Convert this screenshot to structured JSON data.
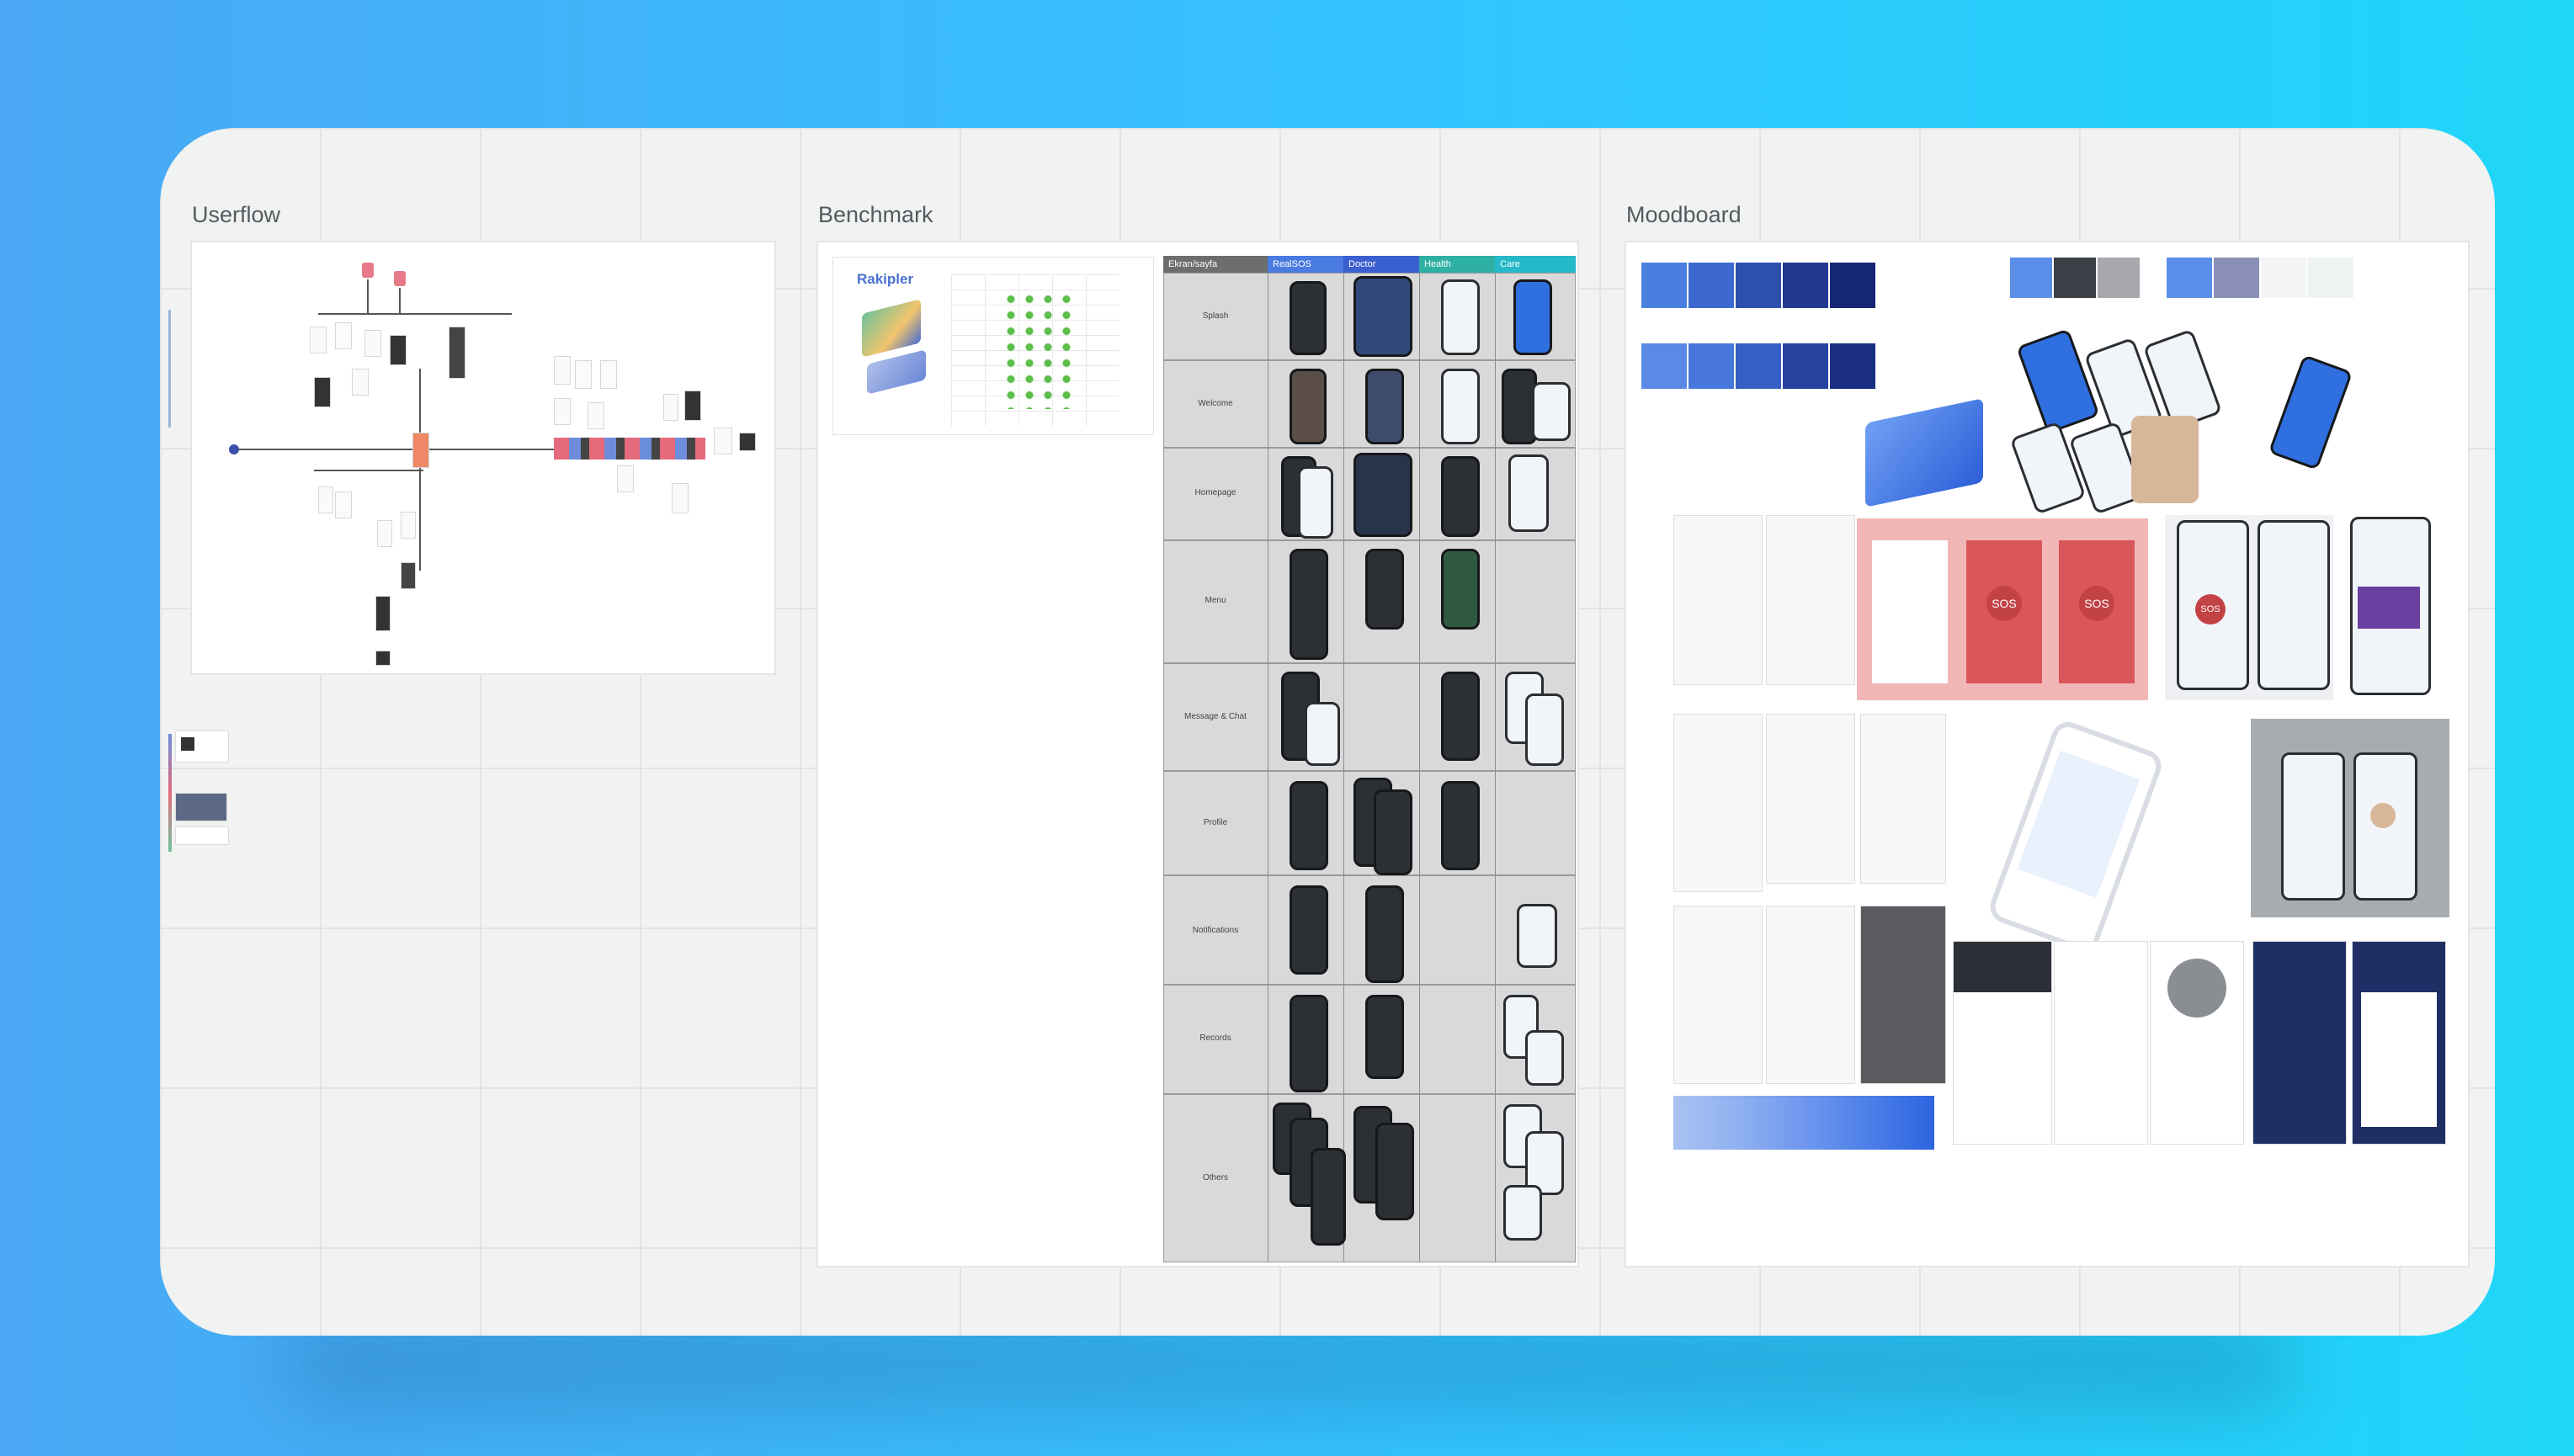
{
  "frames": {
    "userflow": {
      "title": "Userflow"
    },
    "benchmark": {
      "title": "Benchmark",
      "card_title": "Rakipler",
      "table_headers": [
        "Ekran/sayfa",
        "RealSOS",
        "Doctor",
        "Health",
        "Care"
      ],
      "rows": [
        "Splash",
        "Welcome",
        "Homepage",
        "Menu",
        "Message & Chat",
        "Profile",
        "Notifications",
        "Records",
        "Others"
      ]
    },
    "moodboard": {
      "title": "Moodboard",
      "sos_label": "SOS"
    }
  },
  "colors": {
    "palette_row_1": [
      "#4a7fe0",
      "#3c68cf",
      "#2d50ae",
      "#21398f",
      "#152676"
    ],
    "palette_row_2": [
      "#5a8ae6",
      "#4877dc",
      "#365fc4",
      "#2743a0",
      "#1a2e82"
    ],
    "palette_small_a": [
      "#5b8ee8",
      "#3d3f46",
      "#a6a8ae"
    ],
    "palette_small_b": [
      "#5b8ee8",
      "#8a8fb5",
      "#f4f5f7",
      "#eef3f0"
    ],
    "gradient_bar": [
      "#a9c2f2",
      "#8fb0f0",
      "#6f97ee",
      "#4c7fe8",
      "#2e64e0"
    ],
    "sos_red": "#d9575a"
  }
}
